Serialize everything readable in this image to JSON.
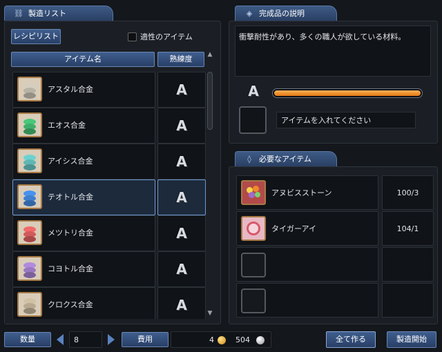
{
  "left_tab": {
    "icon": "link-icon",
    "title": "製造リスト"
  },
  "recipe_button": "レシピリスト",
  "suitable_filter": {
    "label": "適性のアイテム",
    "checked": false
  },
  "table_headers": {
    "name": "アイテム名",
    "proficiency": "熟練度"
  },
  "recipes": [
    {
      "name": "アスタル合金",
      "grade": "A",
      "icon": "alloy-ingot-icon",
      "color": "#b9b3a6"
    },
    {
      "name": "エオス合金",
      "grade": "A",
      "icon": "alloy-ingot-icon",
      "color": "#3fae6a"
    },
    {
      "name": "アイシス合金",
      "grade": "A",
      "icon": "alloy-ingot-icon",
      "color": "#5fb7b4"
    },
    {
      "name": "テオトル合金",
      "grade": "A",
      "icon": "alloy-ingot-icon",
      "color": "#3f7fd0",
      "selected": true
    },
    {
      "name": "メツトリ合金",
      "grade": "A",
      "icon": "alloy-ingot-icon",
      "color": "#d25a5a"
    },
    {
      "name": "コヨトル合金",
      "grade": "A",
      "icon": "alloy-ingot-icon",
      "color": "#9a78c0"
    },
    {
      "name": "クロクス合金",
      "grade": "A",
      "icon": "alloy-ingot-icon",
      "color": "#b7a98f"
    }
  ],
  "desc_tab": {
    "icon": "gem-icon",
    "title": "完成品の説明"
  },
  "description": "衝撃耐性があり、多くの職人が欲している材料。",
  "result": {
    "grade": "A",
    "progress": 1.0,
    "placeholder": "アイテムを入れてください"
  },
  "required_tab": {
    "icon": "bag-icon",
    "title": "必要なアイテム"
  },
  "required_items": [
    {
      "name": "アヌビスストーン",
      "count": "100/3",
      "icon": "anubis-stone-icon"
    },
    {
      "name": "タイガーアイ",
      "count": "104/1",
      "icon": "tiger-eye-icon"
    },
    {
      "name": "",
      "count": "",
      "icon": ""
    },
    {
      "name": "",
      "count": "",
      "icon": ""
    }
  ],
  "footer": {
    "quantity_label": "数量",
    "quantity_value": "8",
    "cost_label": "費用",
    "cost_gold": "4",
    "cost_silver": "504",
    "make_all": "全て作る",
    "start": "製造開始"
  },
  "colors": {
    "accent": "#3f5e8e",
    "gauge": "#f08a1a",
    "selected": "#6f9ad4"
  }
}
